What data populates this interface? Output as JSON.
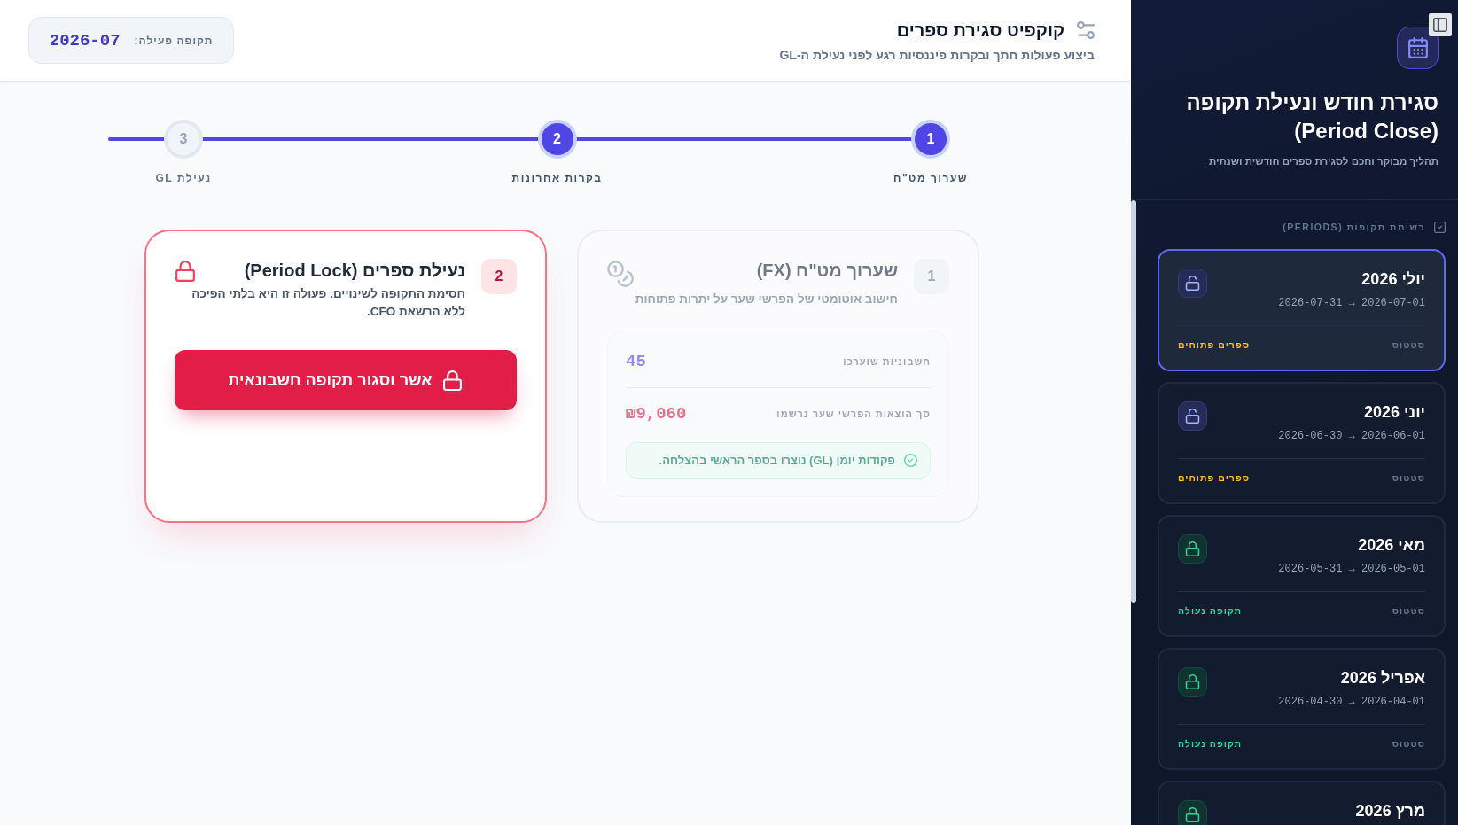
{
  "sidebar": {
    "title": "סגירת חודש ונעילת תקופה (Period Close)",
    "subtitle": "תהליך מבוקר וחכם לסגירת ספרים חודשית ושנתית",
    "section_label": "רשימת תקופות (PERIODS)",
    "periods": [
      {
        "name": "יולי 2026",
        "range": "2026-07-01 → 2026-07-31",
        "status_label": "סטטוס",
        "status": "ספרים פתוחים",
        "locked": false,
        "selected": true
      },
      {
        "name": "יוני 2026",
        "range": "2026-06-01 → 2026-06-30",
        "status_label": "סטטוס",
        "status": "ספרים פתוחים",
        "locked": false,
        "selected": false
      },
      {
        "name": "מאי 2026",
        "range": "2026-05-01 → 2026-05-31",
        "status_label": "סטטוס",
        "status": "תקופה נעולה",
        "locked": true,
        "selected": false
      },
      {
        "name": "אפריל 2026",
        "range": "2026-04-01 → 2026-04-30",
        "status_label": "סטטוס",
        "status": "תקופה נעולה",
        "locked": true,
        "selected": false
      },
      {
        "name": "מרץ 2026",
        "locked": true,
        "selected": false
      }
    ]
  },
  "header": {
    "title": "קוקפיט סגירת ספרים",
    "subtitle": "ביצוע פעולות חתך ובקרות פיננסיות רגע לפני נעילת ה-GL",
    "period_label": "תקופה פעילה:",
    "period_value": "2026-07"
  },
  "steps": [
    {
      "number": "1",
      "label": "שערוך מט\"ח",
      "reached": true
    },
    {
      "number": "2",
      "label": "בקרות אחרונות",
      "reached": true
    },
    {
      "number": "3",
      "label": "נעילת GL",
      "reached": false
    }
  ],
  "cards": [
    {
      "kind": "fx",
      "number": "1",
      "title": "שערוך מט\"ח (FX)",
      "description": "חישוב אוטומטי של הפרשי שער על יתרות פתוחות",
      "active": false,
      "stats": [
        {
          "kind": "count",
          "label": "חשבוניות שוערכו",
          "value": "45"
        },
        {
          "kind": "amount",
          "label": "סך הוצאות הפרשי שער נרשמו",
          "value": "₪9,060"
        }
      ],
      "message": "פקודות יומן (GL) נוצרו בספר הראשי בהצלחה."
    },
    {
      "kind": "lock",
      "number": "2",
      "title": "נעילת ספרים (Period Lock)",
      "description": "חסימת התקופה לשינויים. פעולה זו היא בלתי הפיכה ללא הרשאת CFO.",
      "active": true,
      "button": "אשר וסגור תקופה חשבונאית"
    }
  ]
}
